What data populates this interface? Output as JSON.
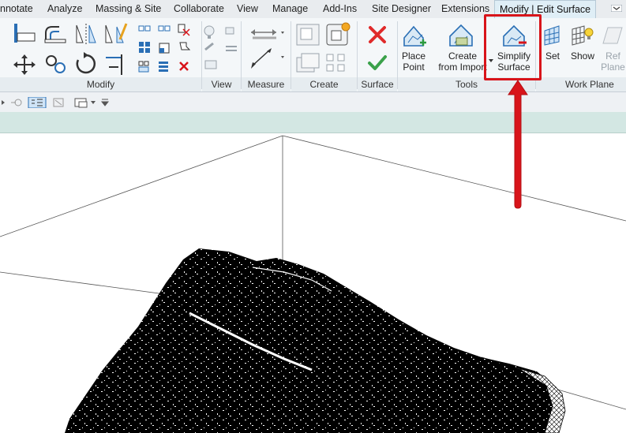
{
  "tabs": [
    {
      "label": "nnotate"
    },
    {
      "label": "Analyze"
    },
    {
      "label": "Massing & Site"
    },
    {
      "label": "Collaborate"
    },
    {
      "label": "View"
    },
    {
      "label": "Manage"
    },
    {
      "label": "Add-Ins"
    },
    {
      "label": "Site Designer"
    },
    {
      "label": "Extensions"
    },
    {
      "label": "Modify | Edit Surface",
      "active": true
    }
  ],
  "panels": {
    "modify": "Modify",
    "view": "View",
    "measure": "Measure",
    "create": "Create",
    "surface": "Surface",
    "tools": "Tools",
    "work_plane": "Work Plane"
  },
  "tools": {
    "place_point": [
      "Place",
      "Point"
    ],
    "create_from_import": [
      "Create",
      "from Import"
    ],
    "simplify_surface": [
      "Simplify",
      "Surface"
    ],
    "set": "Set",
    "show": "Show",
    "ref_plane": [
      "Ref",
      "Plane"
    ]
  },
  "colors": {
    "highlight": "#d8141a",
    "context_bar": "#d3e7e3",
    "active_tab": "#dfeef6"
  },
  "icons": {
    "cancel": "red-x-icon",
    "finish": "green-check-icon"
  }
}
